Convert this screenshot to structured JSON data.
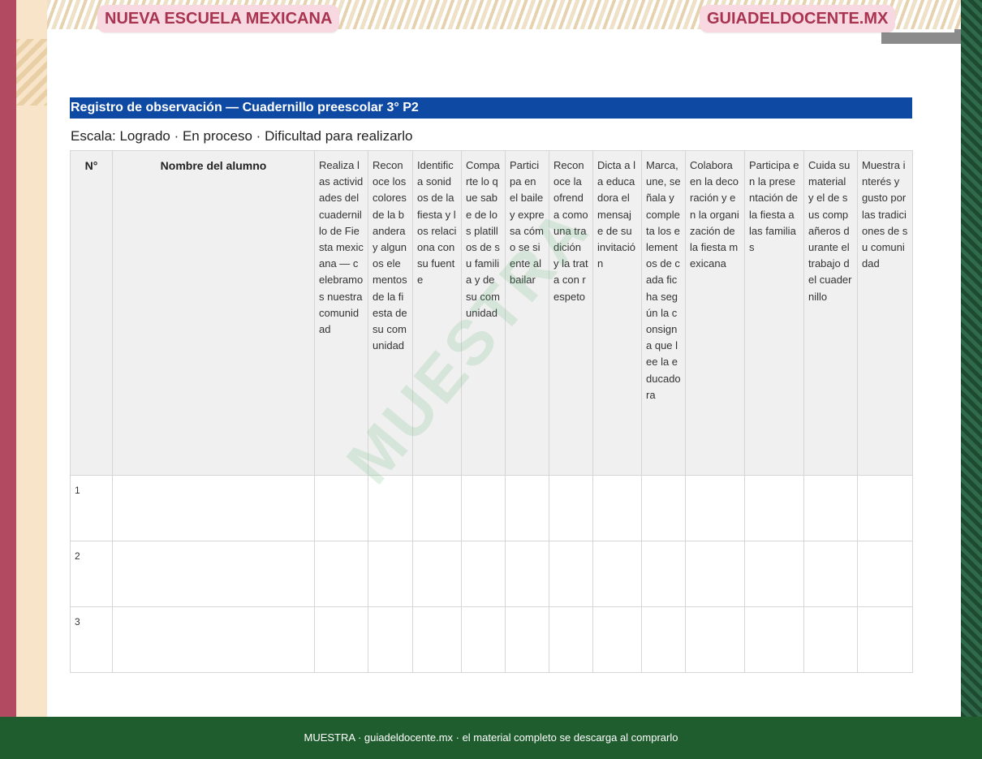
{
  "header": {
    "left_badge": "NUEVA ESCUELA MEXICANA",
    "right_badge": "GUIADELDOCENTE.MX"
  },
  "document": {
    "title": "Registro de observación — Cuadernillo preescolar 3° P2",
    "scale": "Escala: Logrado · En proceso · Dificultad para realizarlo"
  },
  "table": {
    "num_header": "N°",
    "name_header": "Nombre del alumno",
    "indicators": [
      "Realiza las actividades del cuadernillo de Fiesta mexicana — celebramos nuestra comunidad",
      "Reconoce los colores de la bandera y algunos elementos de la fiesta de su comunidad",
      "Identifica sonidos de la fiesta y los relaciona con su fuente",
      "Comparte lo que sabe de los platillos de su familia y de su comunidad",
      "Participa en el baile y expresa cómo se siente al bailar",
      "Reconoce la ofrenda como una tradición y la trata con respeto",
      "Dicta a la educadora el mensaje de su invitación",
      "Marca, une, señala y completa los elementos de cada ficha según la consigna que lee la educadora",
      "Colabora en la decoración y en la organización de la fiesta mexicana",
      "Participa en la presentación de la fiesta a las familias",
      "Cuida su material y el de sus compañeros durante el trabajo del cuadernillo",
      "Muestra interés y gusto por las tradiciones de su comunidad"
    ],
    "rows": [
      {
        "num": "1"
      },
      {
        "num": "2"
      },
      {
        "num": "3"
      }
    ]
  },
  "watermark": "MUESTRA",
  "footer": {
    "text": "MUESTRA · guiadeldocente.mx · el material completo se descarga al comprarlo"
  },
  "colors": {
    "title_bar": "#0e4aa3",
    "footer_bg": "#1f5d2f",
    "badge_text": "#a8344f",
    "badge_bg": "#f8d9e2",
    "watermark": "#4caf67"
  }
}
